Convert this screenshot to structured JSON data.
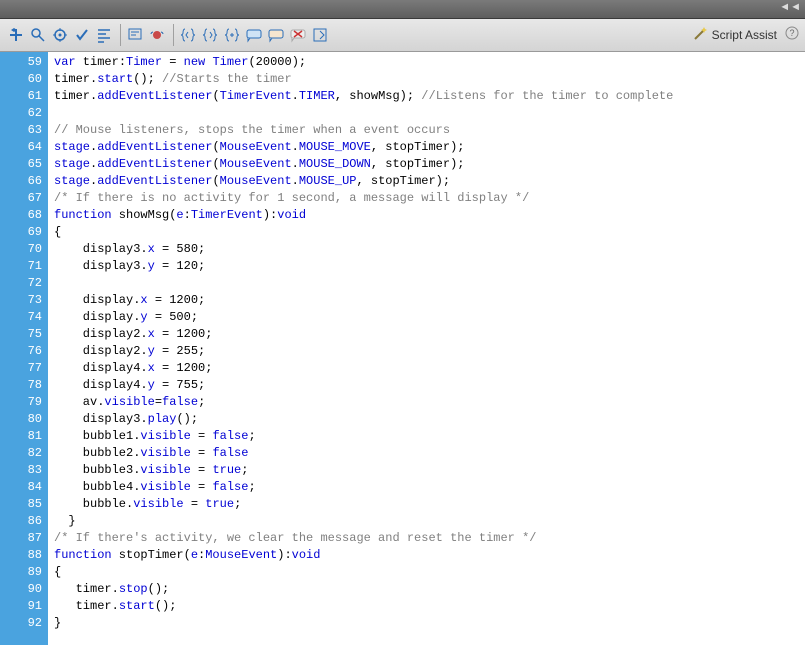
{
  "topbar": {
    "collapse_label": "◄◄"
  },
  "toolbar": {
    "script_assist_label": "Script Assist",
    "help_label": "?"
  },
  "icons": {
    "add1": "add-script-icon",
    "find": "find-icon",
    "target": "insert-target-icon",
    "check": "check-syntax-icon",
    "format": "auto-format-icon",
    "code1": "show-code-hint-icon",
    "debug": "debug-options-icon",
    "brace1": "collapse-between-braces-icon",
    "brace2": "collapse-selection-icon",
    "brace3": "expand-all-icon",
    "comment1": "apply-block-comment-icon",
    "comment2": "apply-line-comment-icon",
    "comment3": "remove-comment-icon",
    "wrap": "show-hide-toolbox-icon",
    "wand": "script-assist-icon"
  },
  "lines": [
    {
      "n": "59",
      "segs": [
        {
          "t": "var",
          "c": "kw"
        },
        {
          "t": " timer:"
        },
        {
          "t": "Timer",
          "c": "type"
        },
        {
          "t": " = "
        },
        {
          "t": "new",
          "c": "kw"
        },
        {
          "t": " "
        },
        {
          "t": "Timer",
          "c": "type"
        },
        {
          "t": "(20000);"
        }
      ]
    },
    {
      "n": "60",
      "segs": [
        {
          "t": "timer."
        },
        {
          "t": "start",
          "c": "prop"
        },
        {
          "t": "(); "
        },
        {
          "t": "//Starts the timer",
          "c": "cmt"
        }
      ]
    },
    {
      "n": "61",
      "segs": [
        {
          "t": "timer."
        },
        {
          "t": "addEventListener",
          "c": "prop"
        },
        {
          "t": "("
        },
        {
          "t": "TimerEvent",
          "c": "type"
        },
        {
          "t": "."
        },
        {
          "t": "TIMER",
          "c": "prop"
        },
        {
          "t": ", showMsg); "
        },
        {
          "t": "//Listens for the timer to complete",
          "c": "cmt"
        }
      ]
    },
    {
      "n": "62",
      "segs": []
    },
    {
      "n": "63",
      "segs": [
        {
          "t": "// Mouse listeners, stops the timer when a event occurs",
          "c": "cmt"
        }
      ]
    },
    {
      "n": "64",
      "segs": [
        {
          "t": "stage",
          "c": "prop"
        },
        {
          "t": "."
        },
        {
          "t": "addEventListener",
          "c": "prop"
        },
        {
          "t": "("
        },
        {
          "t": "MouseEvent",
          "c": "type"
        },
        {
          "t": "."
        },
        {
          "t": "MOUSE_MOVE",
          "c": "prop"
        },
        {
          "t": ", stopTimer);"
        }
      ]
    },
    {
      "n": "65",
      "segs": [
        {
          "t": "stage",
          "c": "prop"
        },
        {
          "t": "."
        },
        {
          "t": "addEventListener",
          "c": "prop"
        },
        {
          "t": "("
        },
        {
          "t": "MouseEvent",
          "c": "type"
        },
        {
          "t": "."
        },
        {
          "t": "MOUSE_DOWN",
          "c": "prop"
        },
        {
          "t": ", stopTimer);"
        }
      ]
    },
    {
      "n": "66",
      "segs": [
        {
          "t": "stage",
          "c": "prop"
        },
        {
          "t": "."
        },
        {
          "t": "addEventListener",
          "c": "prop"
        },
        {
          "t": "("
        },
        {
          "t": "MouseEvent",
          "c": "type"
        },
        {
          "t": "."
        },
        {
          "t": "MOUSE_UP",
          "c": "prop"
        },
        {
          "t": ", stopTimer);"
        }
      ]
    },
    {
      "n": "67",
      "segs": [
        {
          "t": "/* If there is no activity for 1 second, a message will display */",
          "c": "cmt"
        }
      ]
    },
    {
      "n": "68",
      "segs": [
        {
          "t": "function",
          "c": "kw"
        },
        {
          "t": " showMsg("
        },
        {
          "t": "e",
          "c": "prop"
        },
        {
          "t": ":"
        },
        {
          "t": "TimerEvent",
          "c": "type"
        },
        {
          "t": "):"
        },
        {
          "t": "void",
          "c": "kw"
        }
      ]
    },
    {
      "n": "69",
      "segs": [
        {
          "t": "{"
        }
      ]
    },
    {
      "n": "70",
      "segs": [
        {
          "t": "    display3."
        },
        {
          "t": "x",
          "c": "prop"
        },
        {
          "t": " = 580;"
        }
      ]
    },
    {
      "n": "71",
      "segs": [
        {
          "t": "    display3."
        },
        {
          "t": "y",
          "c": "prop"
        },
        {
          "t": " = 120;"
        }
      ]
    },
    {
      "n": "72",
      "segs": []
    },
    {
      "n": "73",
      "segs": [
        {
          "t": "    display."
        },
        {
          "t": "x",
          "c": "prop"
        },
        {
          "t": " = 1200;"
        }
      ]
    },
    {
      "n": "74",
      "segs": [
        {
          "t": "    display."
        },
        {
          "t": "y",
          "c": "prop"
        },
        {
          "t": " = 500;"
        }
      ]
    },
    {
      "n": "75",
      "segs": [
        {
          "t": "    display2."
        },
        {
          "t": "x",
          "c": "prop"
        },
        {
          "t": " = 1200;"
        }
      ]
    },
    {
      "n": "76",
      "segs": [
        {
          "t": "    display2."
        },
        {
          "t": "y",
          "c": "prop"
        },
        {
          "t": " = 255;"
        }
      ]
    },
    {
      "n": "77",
      "segs": [
        {
          "t": "    display4."
        },
        {
          "t": "x",
          "c": "prop"
        },
        {
          "t": " = 1200;"
        }
      ]
    },
    {
      "n": "78",
      "segs": [
        {
          "t": "    display4."
        },
        {
          "t": "y",
          "c": "prop"
        },
        {
          "t": " = 755;"
        }
      ]
    },
    {
      "n": "79",
      "segs": [
        {
          "t": "    av."
        },
        {
          "t": "visible",
          "c": "prop"
        },
        {
          "t": "="
        },
        {
          "t": "false",
          "c": "kw"
        },
        {
          "t": ";"
        }
      ]
    },
    {
      "n": "80",
      "segs": [
        {
          "t": "    display3."
        },
        {
          "t": "play",
          "c": "prop"
        },
        {
          "t": "();"
        }
      ]
    },
    {
      "n": "81",
      "segs": [
        {
          "t": "    bubble1."
        },
        {
          "t": "visible",
          "c": "prop"
        },
        {
          "t": " = "
        },
        {
          "t": "false",
          "c": "kw"
        },
        {
          "t": ";"
        }
      ]
    },
    {
      "n": "82",
      "segs": [
        {
          "t": "    bubble2."
        },
        {
          "t": "visible",
          "c": "prop"
        },
        {
          "t": " = "
        },
        {
          "t": "false",
          "c": "kw"
        }
      ]
    },
    {
      "n": "83",
      "segs": [
        {
          "t": "    bubble3."
        },
        {
          "t": "visible",
          "c": "prop"
        },
        {
          "t": " = "
        },
        {
          "t": "true",
          "c": "kw"
        },
        {
          "t": ";"
        }
      ]
    },
    {
      "n": "84",
      "segs": [
        {
          "t": "    bubble4."
        },
        {
          "t": "visible",
          "c": "prop"
        },
        {
          "t": " = "
        },
        {
          "t": "false",
          "c": "kw"
        },
        {
          "t": ";"
        }
      ]
    },
    {
      "n": "85",
      "segs": [
        {
          "t": "    bubble."
        },
        {
          "t": "visible",
          "c": "prop"
        },
        {
          "t": " = "
        },
        {
          "t": "true",
          "c": "kw"
        },
        {
          "t": ";"
        }
      ]
    },
    {
      "n": "86",
      "segs": [
        {
          "t": "  }"
        }
      ]
    },
    {
      "n": "87",
      "segs": [
        {
          "t": "/* If there's activity, we clear the message and reset the timer */",
          "c": "cmt"
        }
      ]
    },
    {
      "n": "88",
      "segs": [
        {
          "t": "function",
          "c": "kw"
        },
        {
          "t": " stopTimer("
        },
        {
          "t": "e",
          "c": "prop"
        },
        {
          "t": ":"
        },
        {
          "t": "MouseEvent",
          "c": "type"
        },
        {
          "t": "):"
        },
        {
          "t": "void",
          "c": "kw"
        }
      ]
    },
    {
      "n": "89",
      "segs": [
        {
          "t": "{"
        }
      ]
    },
    {
      "n": "90",
      "segs": [
        {
          "t": "   timer."
        },
        {
          "t": "stop",
          "c": "prop"
        },
        {
          "t": "();"
        }
      ]
    },
    {
      "n": "91",
      "segs": [
        {
          "t": "   timer."
        },
        {
          "t": "start",
          "c": "prop"
        },
        {
          "t": "();"
        }
      ]
    },
    {
      "n": "92",
      "segs": [
        {
          "t": "}"
        }
      ]
    }
  ]
}
